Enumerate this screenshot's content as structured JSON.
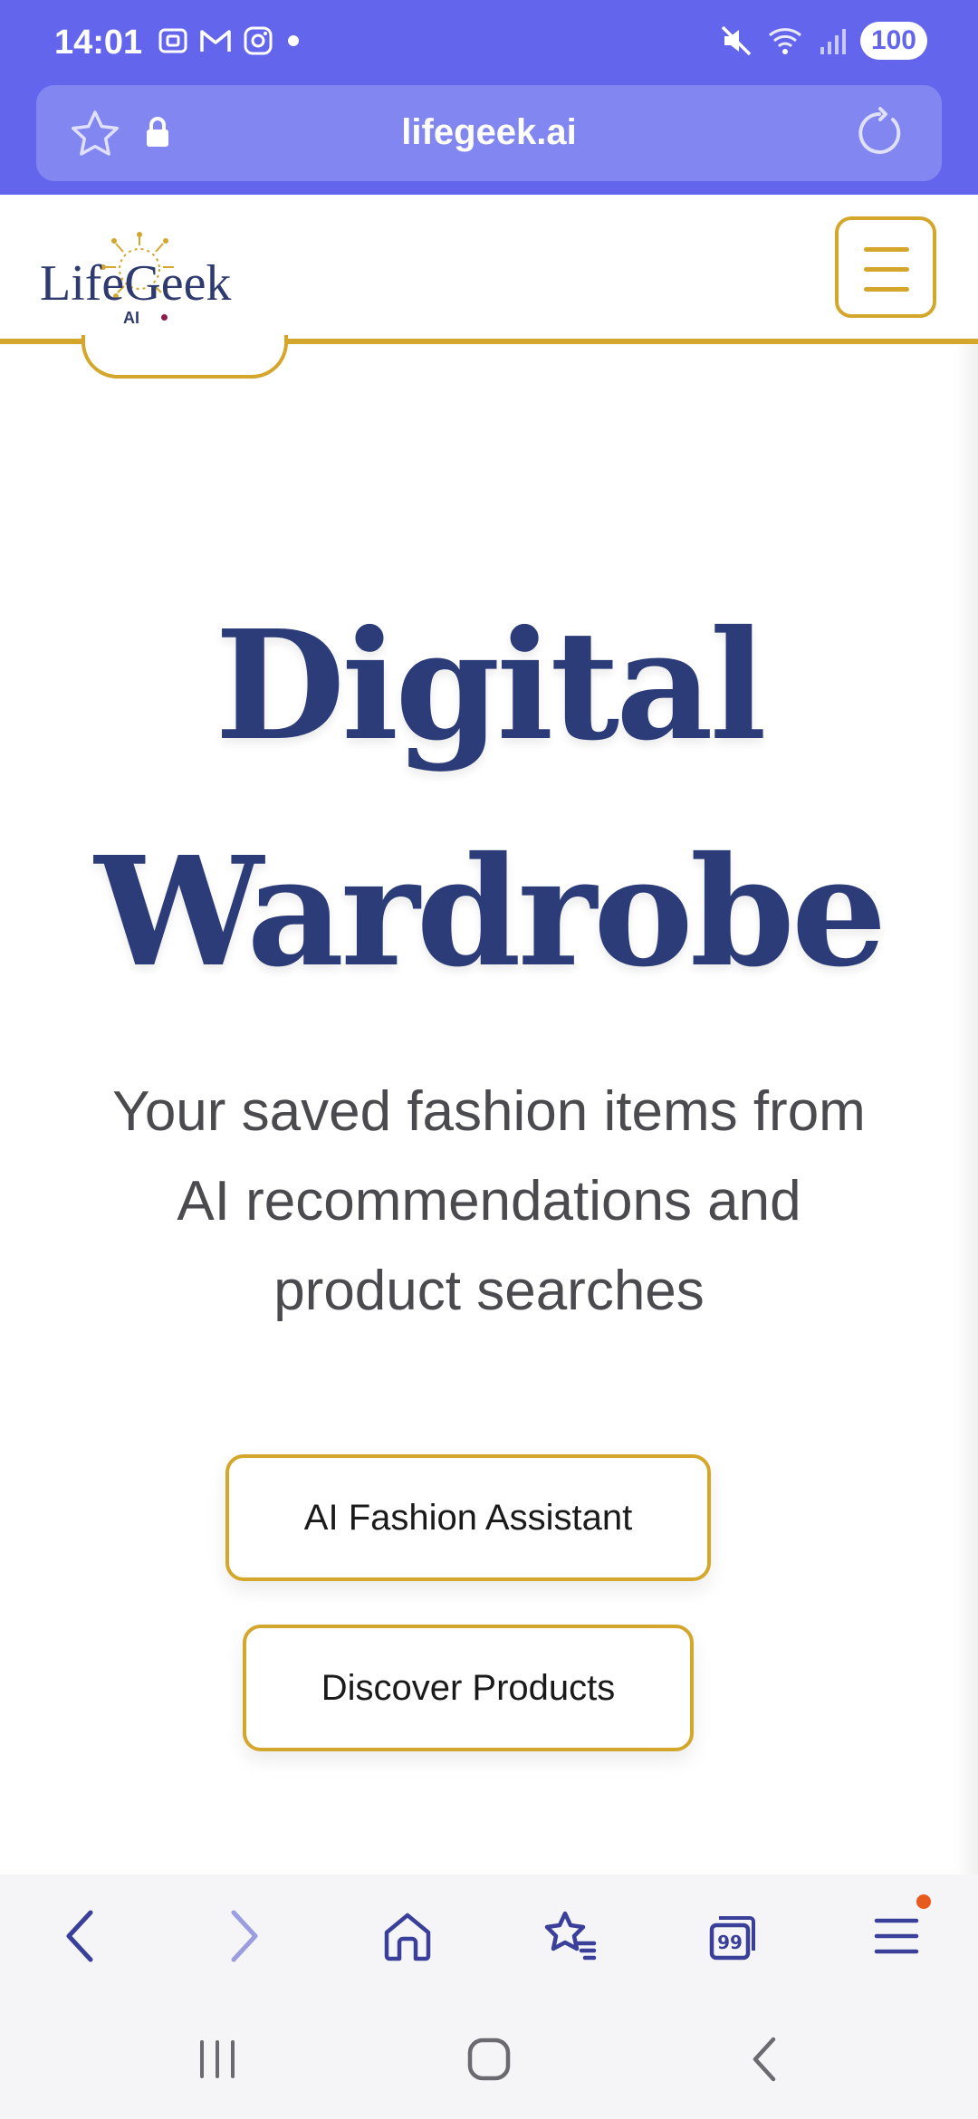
{
  "status_bar": {
    "time": "14:01",
    "battery": "100"
  },
  "browser": {
    "url": "lifegeek.ai"
  },
  "site": {
    "logo_text": "LifeGeek",
    "logo_sub": "AI"
  },
  "hero": {
    "title_line1": "Digital",
    "title_line2": "Wardrobe",
    "subtitle": "Your saved fashion items from AI recommendations and product searches"
  },
  "actions": {
    "assistant_label": "AI Fashion Assistant",
    "discover_label": "Discover Products"
  },
  "colors": {
    "brand_purple": "#6366ec",
    "accent_gold": "#d4a72c",
    "title_navy": "#2c3c78"
  }
}
